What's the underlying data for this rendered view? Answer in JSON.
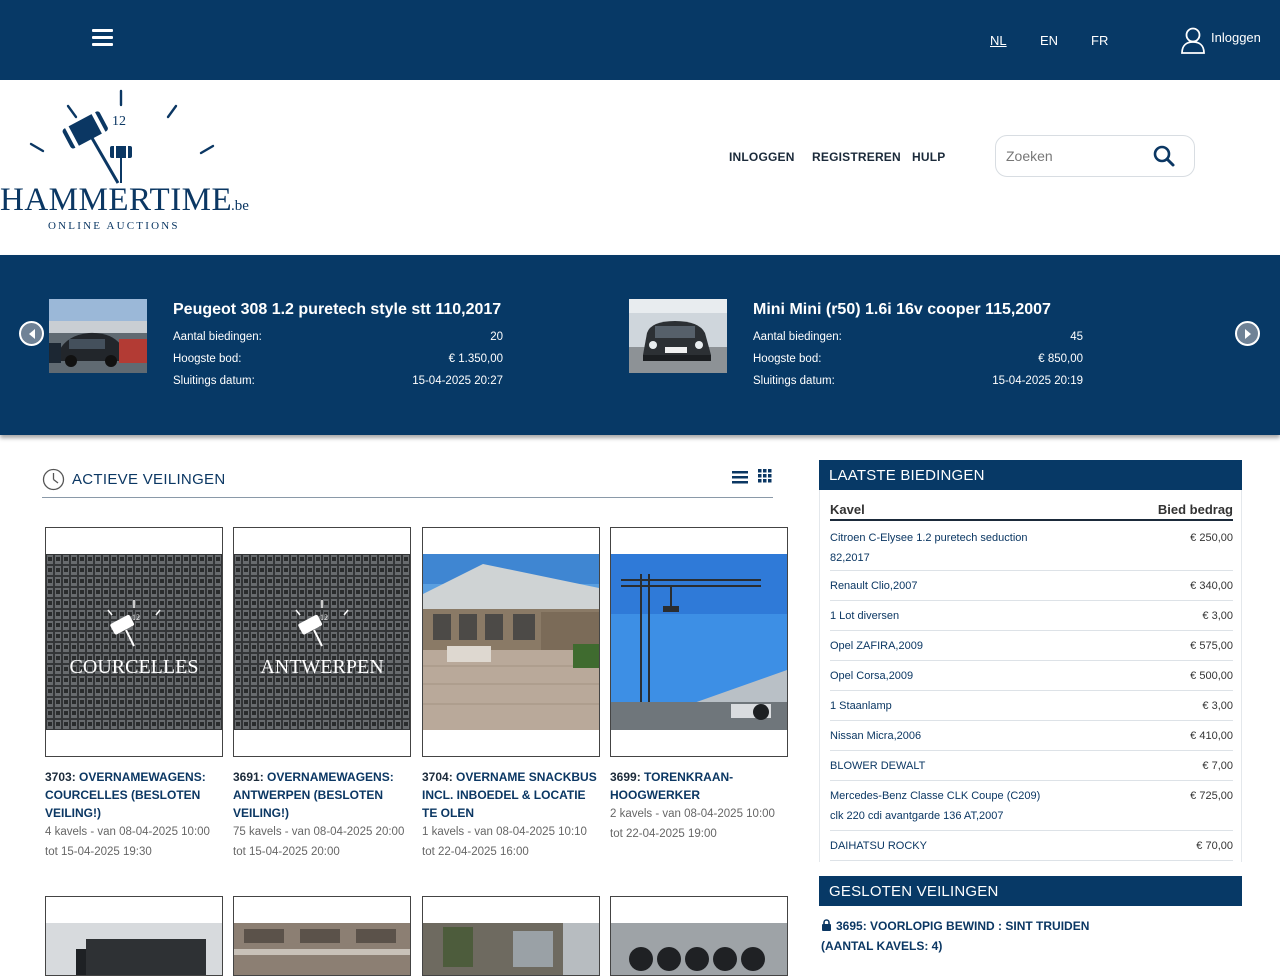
{
  "topbar": {
    "languages": [
      "NL",
      "EN",
      "FR"
    ],
    "active_language": "NL",
    "login_label": "Inloggen"
  },
  "header": {
    "logo_text": "HAMMERTIME",
    "logo_suffix": ".be",
    "logo_tagline": "ONLINE AUCTIONS",
    "logo_clock_number": "12",
    "nav": [
      "INLOGGEN",
      "REGISTREREN",
      "HULP"
    ],
    "search_placeholder": "Zoeken"
  },
  "carousel": {
    "slides": [
      {
        "title": "Peugeot 308 1.2 puretech style stt 110,2017",
        "rows": [
          {
            "label": "Aantal biedingen:",
            "value": "20"
          },
          {
            "label": "Hoogste bod:",
            "value": "€ 1.350,00"
          },
          {
            "label": "Sluitings datum:",
            "value": "15-04-2025 20:27"
          }
        ]
      },
      {
        "title": "Mini Mini (r50) 1.6i 16v cooper 115,2007",
        "rows": [
          {
            "label": "Aantal biedingen:",
            "value": "45"
          },
          {
            "label": "Hoogste bod:",
            "value": "€ 850,00"
          },
          {
            "label": "Sluitings datum:",
            "value": "15-04-2025 20:19"
          }
        ]
      }
    ]
  },
  "active_auctions": {
    "title": "ACTIEVE VEILINGEN",
    "cards": [
      {
        "num": "3703:",
        "title": "OVERNAMEWAGENS: COURCELLES (BESLOTEN VEILING!)",
        "overlay": "COURCELLES",
        "meta1": "4 kavels - van 08-04-2025 10:00",
        "meta2": "tot 15-04-2025 19:30"
      },
      {
        "num": "3691:",
        "title": "OVERNAMEWAGENS: ANTWERPEN (BESLOTEN VEILING!)",
        "overlay": "ANTWERPEN",
        "meta1": "75 kavels - van 08-04-2025 20:00",
        "meta2": "tot 15-04-2025 20:00"
      },
      {
        "num": "3704:",
        "title": "OVERNAME SNACKBUS INCL. INBOEDEL & LOCATIE TE OLEN",
        "overlay": "",
        "meta1": "1 kavels - van 08-04-2025 10:10",
        "meta2": "tot 22-04-2025 16:00"
      },
      {
        "num": "3699:",
        "title": "TORENKRAAN-HOOGWERKER",
        "overlay": "",
        "meta1": "2 kavels - van 08-04-2025 10:00",
        "meta2": "tot 22-04-2025 19:00"
      }
    ]
  },
  "latest_bids": {
    "title": "LAATSTE BIEDINGEN",
    "col_lot": "Kavel",
    "col_amount": "Bied bedrag",
    "rows": [
      {
        "lot": "Citroen C-Elysee 1.2 puretech seduction 82,2017",
        "amount": "€ 250,00"
      },
      {
        "lot": "Renault Clio,2007",
        "amount": "€ 340,00"
      },
      {
        "lot": "1 Lot diversen",
        "amount": "€ 3,00"
      },
      {
        "lot": "Opel ZAFIRA,2009",
        "amount": "€ 575,00"
      },
      {
        "lot": "Opel Corsa,2009",
        "amount": "€ 500,00"
      },
      {
        "lot": "1 Staanlamp",
        "amount": "€ 3,00"
      },
      {
        "lot": "Nissan Micra,2006",
        "amount": "€ 410,00"
      },
      {
        "lot": "BLOWER DEWALT",
        "amount": "€ 7,00"
      },
      {
        "lot": "Mercedes-Benz Classe CLK Coupe (C209) clk 220 cdi avantgarde 136 AT,2007",
        "amount": "€ 725,00"
      },
      {
        "lot": "DAIHATSU ROCKY",
        "amount": "€ 70,00"
      }
    ]
  },
  "closed_auctions": {
    "title": "GESLOTEN VEILINGEN",
    "items": [
      {
        "text": "3695: VOORLOPIG BEWIND : SINT TRUIDEN (AANTAL KAVELS: 4)"
      }
    ]
  },
  "colors": {
    "brand_navy": "#073966",
    "link_navy": "#0b3763",
    "text_dark": "#1b2a3a"
  }
}
